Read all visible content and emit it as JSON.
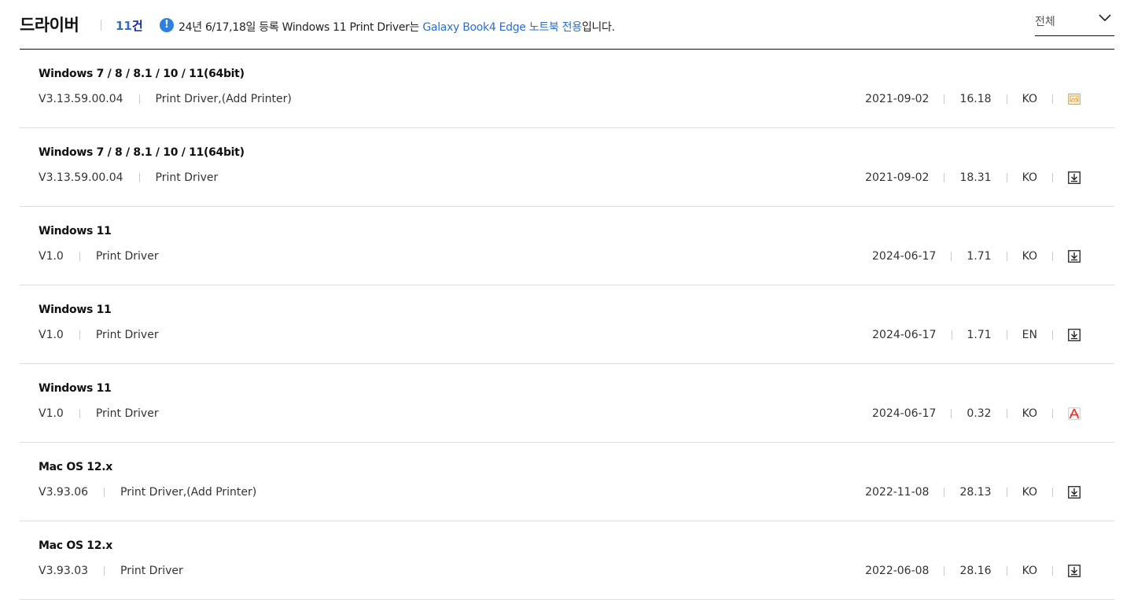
{
  "header": {
    "title": "드라이버",
    "count_num": "11",
    "count_unit": "건",
    "notice_prefix": "24년 6/17,18일 등록 Windows 11 Print Driver는 ",
    "notice_highlight": "Galaxy Book4 Edge 노트북 전용",
    "notice_suffix": "입니다.",
    "filter_value": "전체"
  },
  "colors": {
    "accent_blue": "#2a6fd6",
    "info_icon": "#2d7fe0",
    "pdf_red": "#e03a2f",
    "image_orange": "#e8a33a"
  },
  "rows": [
    {
      "os": "Windows 7 / 8 / 8.1 / 10 / 11(64bit)",
      "version": "V3.13.59.00.04",
      "desc": "Print Driver,(Add Printer)",
      "date": "2021-09-02",
      "size": "16.18",
      "lang": "KO",
      "icon": "image-file-icon"
    },
    {
      "os": "Windows 7 / 8 / 8.1 / 10 / 11(64bit)",
      "version": "V3.13.59.00.04",
      "desc": "Print Driver",
      "date": "2021-09-02",
      "size": "18.31",
      "lang": "KO",
      "icon": "download-icon"
    },
    {
      "os": "Windows 11",
      "version": "V1.0",
      "desc": "Print Driver",
      "date": "2024-06-17",
      "size": "1.71",
      "lang": "KO",
      "icon": "download-icon"
    },
    {
      "os": "Windows 11",
      "version": "V1.0",
      "desc": "Print Driver",
      "date": "2024-06-17",
      "size": "1.71",
      "lang": "EN",
      "icon": "download-icon"
    },
    {
      "os": "Windows 11",
      "version": "V1.0",
      "desc": "Print Driver",
      "date": "2024-06-17",
      "size": "0.32",
      "lang": "KO",
      "icon": "pdf-icon"
    },
    {
      "os": "Mac OS 12.x",
      "version": "V3.93.06",
      "desc": "Print Driver,(Add Printer)",
      "date": "2022-11-08",
      "size": "28.13",
      "lang": "KO",
      "icon": "download-icon"
    },
    {
      "os": "Mac OS 12.x",
      "version": "V3.93.03",
      "desc": "Print Driver",
      "date": "2022-06-08",
      "size": "28.16",
      "lang": "KO",
      "icon": "download-icon"
    }
  ]
}
